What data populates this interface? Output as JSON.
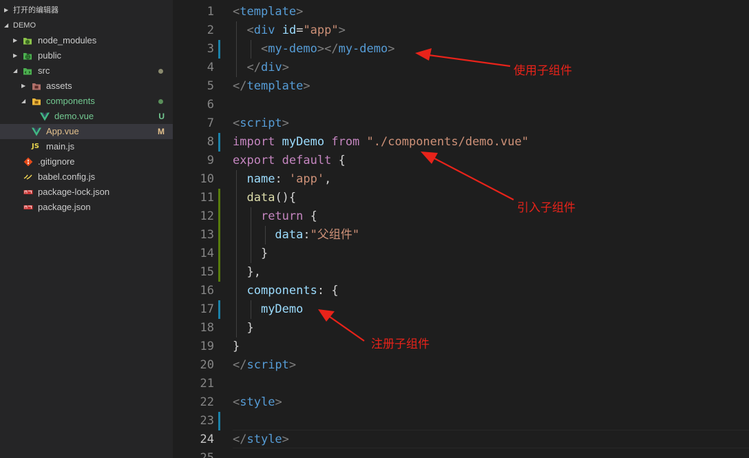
{
  "explorer": {
    "open_editors": "打开的编辑器",
    "root": "DEMO",
    "items": [
      {
        "label": "node_modules",
        "icon": "folder-node-icon",
        "status": ""
      },
      {
        "label": "public",
        "icon": "folder-public-icon",
        "status": ""
      },
      {
        "label": "src",
        "icon": "folder-src-icon",
        "status": "dot"
      },
      {
        "label": "assets",
        "icon": "folder-assets-icon",
        "status": ""
      },
      {
        "label": "components",
        "icon": "folder-components-icon",
        "status": "dot"
      },
      {
        "label": "demo.vue",
        "icon": "vue-icon",
        "status": "U"
      },
      {
        "label": "App.vue",
        "icon": "vue-icon",
        "status": "M"
      },
      {
        "label": "main.js",
        "icon": "js-icon",
        "status": ""
      },
      {
        "label": ".gitignore",
        "icon": "git-icon",
        "status": ""
      },
      {
        "label": "babel.config.js",
        "icon": "babel-icon",
        "status": ""
      },
      {
        "label": "package-lock.json",
        "icon": "npm-icon",
        "status": ""
      },
      {
        "label": "package.json",
        "icon": "npm-icon",
        "status": ""
      }
    ]
  },
  "editor": {
    "line_numbers": [
      "1",
      "2",
      "3",
      "4",
      "5",
      "6",
      "7",
      "8",
      "9",
      "10",
      "11",
      "12",
      "13",
      "14",
      "15",
      "16",
      "17",
      "18",
      "19",
      "20",
      "21",
      "22",
      "23",
      "24",
      "25"
    ],
    "current_line": "24",
    "code": {
      "t_template": "template",
      "t_div": "div",
      "a_id": "id",
      "s_app": "\"app\"",
      "t_mydemo": "my-demo",
      "t_script": "script",
      "k_import": "import",
      "v_mydemo": "myDemo",
      "k_from": "from",
      "s_path": "\"./components/demo.vue\"",
      "k_export": "export",
      "k_default": "default",
      "v_name": "name",
      "s_app_single": "'app'",
      "f_data": "data",
      "k_return": "return",
      "v_data": "data",
      "s_parent": "\"父组件\"",
      "v_components": "components",
      "v_mydemo2": "myDemo",
      "t_style": "style"
    }
  },
  "annotations": {
    "use_child": "使用子组件",
    "import_child": "引入子组件",
    "register_child": "注册子组件"
  },
  "colors": {
    "annotation": "#e8231a",
    "modified": "#e2c08d",
    "untracked": "#73c991"
  }
}
